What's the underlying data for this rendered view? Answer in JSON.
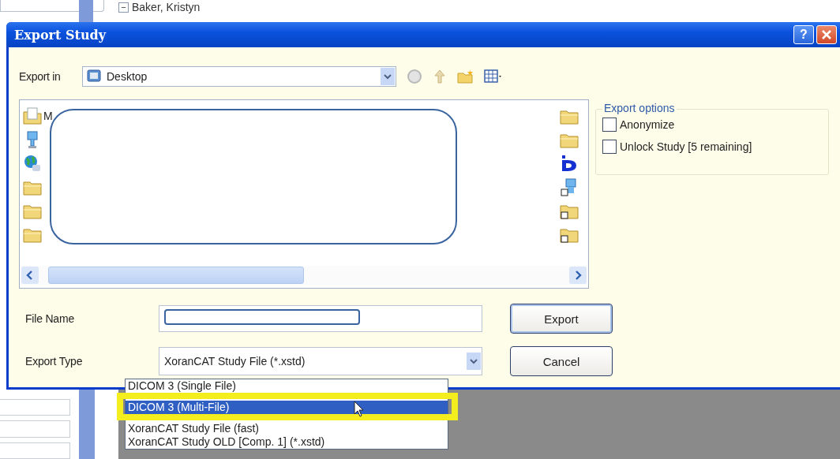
{
  "background": {
    "tree_item": {
      "toggle": "−",
      "label": "Baker, Kristyn"
    }
  },
  "dialog": {
    "title": "Export Study",
    "help_label": "?",
    "export_in": {
      "label": "Export in",
      "value": "Desktop"
    },
    "toolbar": [
      {
        "kind": "back"
      },
      {
        "kind": "up"
      },
      {
        "kind": "new-folder"
      },
      {
        "kind": "views"
      }
    ],
    "file_list": {
      "left_items": [
        {
          "kind": "documents",
          "label": "M"
        },
        {
          "kind": "computer"
        },
        {
          "kind": "network"
        },
        {
          "kind": "folder"
        },
        {
          "kind": "folder"
        },
        {
          "kind": "folder"
        }
      ],
      "right_items": [
        {
          "kind": "folder"
        },
        {
          "kind": "folder"
        },
        {
          "kind": "logo"
        },
        {
          "kind": "computer-shortcut"
        },
        {
          "kind": "folder-shortcut"
        },
        {
          "kind": "folder-shortcut"
        }
      ]
    },
    "export_options": {
      "title": "Export options",
      "options": [
        {
          "label": "Anonymize",
          "checked": false
        },
        {
          "label": "Unlock Study [5 remaining]",
          "checked": false
        }
      ]
    },
    "file_name": {
      "label": "File Name"
    },
    "export_type": {
      "label": "Export Type",
      "value": "XoranCAT Study File (*.xstd)",
      "options": [
        {
          "label": "DICOM 3 (Single File)",
          "selected": false
        },
        {
          "label": "DICOM 3 (Multi-File)",
          "selected": true
        },
        {
          "label": "XoranCAT Study File (fast)",
          "selected": false
        },
        {
          "label": "XoranCAT Study OLD [Comp. 1] (*.xstd)",
          "selected": false
        }
      ]
    },
    "buttons": [
      {
        "label": "Export",
        "default": true
      },
      {
        "label": "Cancel",
        "default": false
      }
    ]
  }
}
